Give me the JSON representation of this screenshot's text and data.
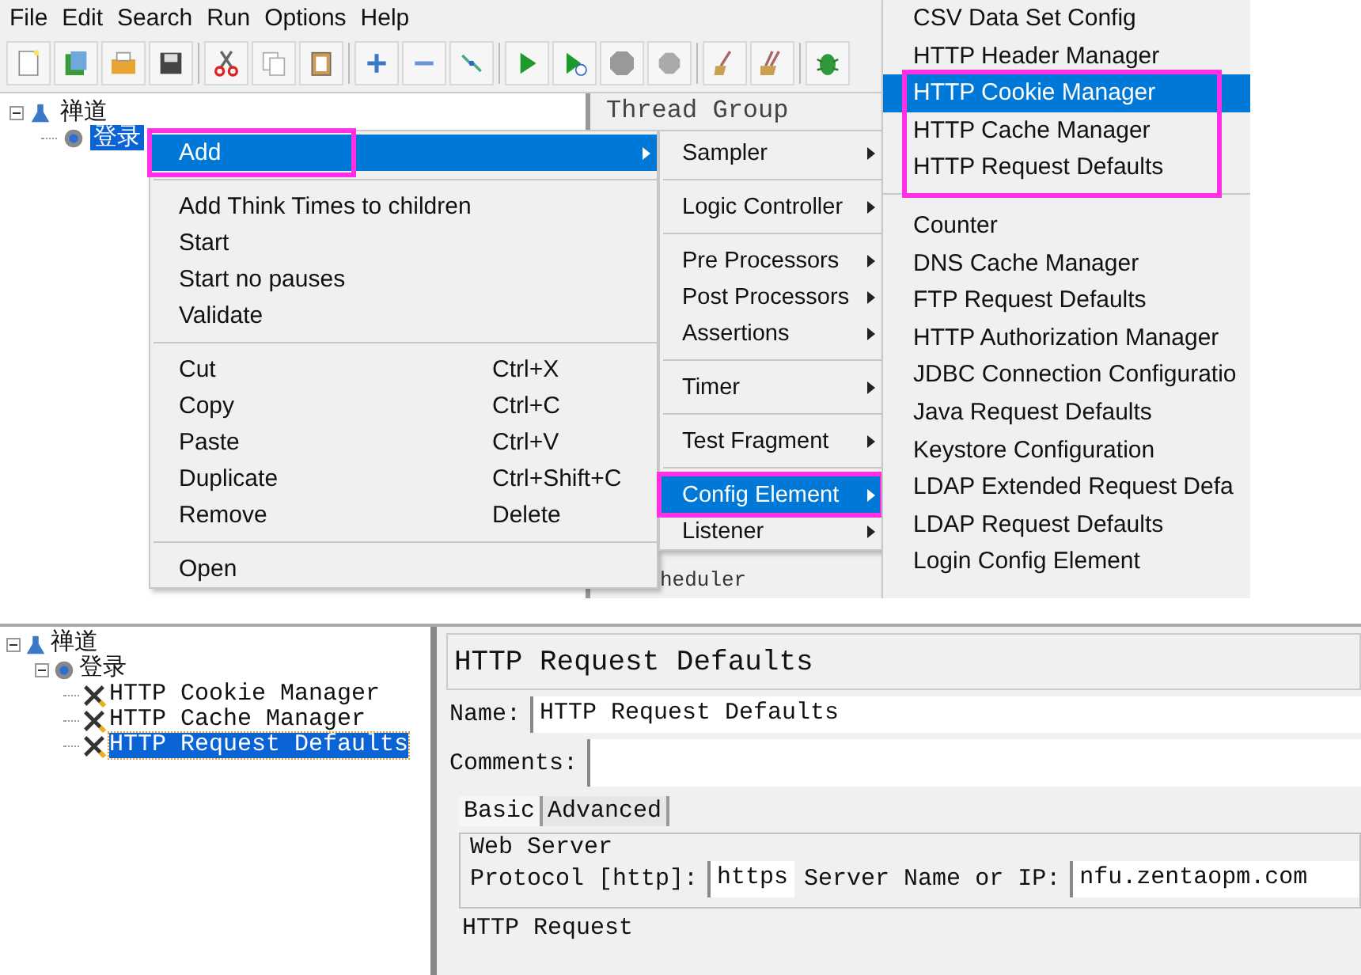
{
  "top_window": {
    "menu_bar": [
      "File",
      "Edit",
      "Search",
      "Run",
      "Options",
      "Help"
    ],
    "tree": [
      {
        "label": "禅道",
        "kind": "test_plan",
        "expanded": true,
        "selected": false,
        "children": [
          {
            "label": "登录",
            "kind": "thread_group",
            "selected": true
          }
        ]
      }
    ],
    "panel_title": "Thread Group",
    "panel_fragment": "heduler",
    "context_menu": [
      {
        "kind": "item",
        "label": "Add",
        "selected": true,
        "has_submenu": true,
        "highlighted": true
      },
      {
        "kind": "separator"
      },
      {
        "kind": "item",
        "label": "Add Think Times to children",
        "selected": false,
        "has_submenu": false,
        "highlighted": false
      },
      {
        "kind": "item",
        "label": "Start",
        "selected": false,
        "has_submenu": false,
        "highlighted": false
      },
      {
        "kind": "item",
        "label": "Start no pauses",
        "selected": false,
        "has_submenu": false,
        "highlighted": false
      },
      {
        "kind": "item",
        "label": "Validate",
        "selected": false,
        "has_submenu": false,
        "highlighted": false
      },
      {
        "kind": "separator"
      },
      {
        "kind": "item",
        "label": "Cut",
        "shortcut": "Ctrl+X",
        "selected": false,
        "has_submenu": false,
        "highlighted": false
      },
      {
        "kind": "item",
        "label": "Copy",
        "shortcut": "Ctrl+C",
        "selected": false,
        "has_submenu": false,
        "highlighted": false
      },
      {
        "kind": "item",
        "label": "Paste",
        "shortcut": "Ctrl+V",
        "selected": false,
        "has_submenu": false,
        "highlighted": false
      },
      {
        "kind": "item",
        "label": "Duplicate",
        "shortcut": "Ctrl+Shift+C",
        "selected": false,
        "has_submenu": false,
        "highlighted": false
      },
      {
        "kind": "item",
        "label": "Remove",
        "shortcut": "Delete",
        "selected": false,
        "has_submenu": false,
        "highlighted": false
      },
      {
        "kind": "separator"
      },
      {
        "kind": "item",
        "label": "Open",
        "selected": false,
        "has_submenu": false,
        "highlighted": false
      }
    ],
    "add_submenu": [
      {
        "kind": "item",
        "label": "Sampler",
        "selected": false,
        "has_submenu": true,
        "highlighted": false
      },
      {
        "kind": "separator"
      },
      {
        "kind": "item",
        "label": "Logic Controller",
        "selected": false,
        "has_submenu": true,
        "highlighted": false
      },
      {
        "kind": "separator"
      },
      {
        "kind": "item",
        "label": "Pre Processors",
        "selected": false,
        "has_submenu": true,
        "highlighted": false
      },
      {
        "kind": "item",
        "label": "Post Processors",
        "selected": false,
        "has_submenu": true,
        "highlighted": false
      },
      {
        "kind": "item",
        "label": "Assertions",
        "selected": false,
        "has_submenu": true,
        "highlighted": false
      },
      {
        "kind": "separator"
      },
      {
        "kind": "item",
        "label": "Timer",
        "selected": false,
        "has_submenu": true,
        "highlighted": false
      },
      {
        "kind": "separator"
      },
      {
        "kind": "item",
        "label": "Test Fragment",
        "selected": false,
        "has_submenu": true,
        "highlighted": false
      },
      {
        "kind": "separator"
      },
      {
        "kind": "item",
        "label": "Config Element",
        "selected": true,
        "has_submenu": true,
        "highlighted": true
      },
      {
        "kind": "item",
        "label": "Listener",
        "selected": false,
        "has_submenu": true,
        "highlighted": false
      }
    ],
    "config_submenu": [
      {
        "highlighted": false,
        "separator_below": false,
        "items": [
          {
            "label": "CSV Data Set Config",
            "selected": false
          },
          {
            "label": "HTTP Header Manager",
            "selected": false
          }
        ]
      },
      {
        "highlighted": true,
        "separator_below": true,
        "items": [
          {
            "label": "HTTP Cookie Manager",
            "selected": true
          },
          {
            "label": "HTTP Cache Manager",
            "selected": false
          },
          {
            "label": "HTTP Request Defaults",
            "selected": false
          }
        ]
      },
      {
        "highlighted": false,
        "separator_below": false,
        "items": [
          {
            "label": "Counter",
            "selected": false
          },
          {
            "label": "DNS Cache Manager",
            "selected": false
          },
          {
            "label": "FTP Request Defaults",
            "selected": false
          },
          {
            "label": "HTTP Authorization Manager",
            "selected": false
          },
          {
            "label": "JDBC Connection Configuratio",
            "selected": false
          },
          {
            "label": "Java Request Defaults",
            "selected": false
          },
          {
            "label": "Keystore Configuration",
            "selected": false
          },
          {
            "label": "LDAP Extended Request Defa",
            "selected": false
          },
          {
            "label": "LDAP Request Defaults",
            "selected": false
          },
          {
            "label": "Login Config Element",
            "selected": false
          }
        ]
      }
    ]
  },
  "bottom_window": {
    "tree": [
      {
        "label": "禅道",
        "kind": "test_plan",
        "expanded": true,
        "selected": false,
        "children": [
          {
            "label": "登录",
            "kind": "thread_group",
            "expanded": true,
            "selected": false,
            "children": [
              {
                "label": "HTTP Cookie Manager",
                "kind": "config_element",
                "selected": false
              },
              {
                "label": "HTTP Cache Manager",
                "kind": "config_element",
                "selected": false
              },
              {
                "label": "HTTP Request Defaults",
                "kind": "config_element",
                "selected": true
              }
            ]
          }
        ]
      }
    ],
    "editor": {
      "title": "HTTP Request Defaults",
      "name_label": "Name:",
      "name_value": "HTTP Request Defaults",
      "comments_label": "Comments:",
      "tabs": [
        {
          "label": "Basic",
          "selected": true
        },
        {
          "label": "Advanced",
          "selected": false
        }
      ],
      "web_server": {
        "legend": "Web Server",
        "protocol_label": "Protocol [http]:",
        "protocol_value": "https",
        "server_label": "Server Name or IP:",
        "server_value": "nfu.zentaopm.com"
      },
      "next_group": "HTTP Request"
    }
  }
}
